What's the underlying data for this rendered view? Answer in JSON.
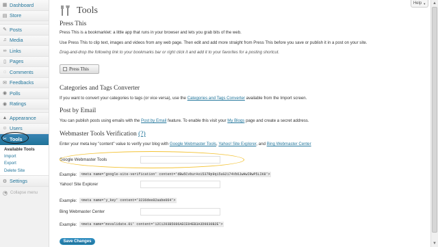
{
  "sidebar": {
    "dashboard": "Dashboard",
    "store": "Store",
    "posts": "Posts",
    "media": "Media",
    "links": "Links",
    "pages": "Pages",
    "comments": "Comments",
    "feedbacks": "Feedbacks",
    "polls": "Polls",
    "ratings": "Ratings",
    "appearance": "Appearance",
    "users": "Users",
    "tools": "Tools",
    "submenu": {
      "available_tools": "Available Tools",
      "import": "Import",
      "export": "Export",
      "delete_site": "Delete Site"
    },
    "settings": "Settings",
    "collapse": "Collapse menu"
  },
  "help": "Help",
  "page": {
    "title": "Tools",
    "press_this": {
      "heading": "Press This",
      "p1": "Press This is a bookmarklet: a little app that runs in your browser and lets you grab bits of the web.",
      "p2": "Use Press This to clip text, images and videos from any web page. Then edit and add more straight from Press This before you save or publish it in a post on your site.",
      "p3": "Drag-and-drop the following link to your bookmarks bar or right click it and add it to your favorites for a posting shortcut.",
      "button": "Press This"
    },
    "converter": {
      "heading": "Categories and Tags Converter",
      "text_before": "If you want to convert your categories to tags (or vice versa), use the",
      "link": "Categories and Tags Converter",
      "text_after": "available from the Import screen."
    },
    "post_by_email": {
      "heading": "Post by Email",
      "text_before": "You can publish posts using emails with the",
      "link": "Post by Email",
      "text_mid": "feature. To enable this visit your",
      "link2": "My Blogs",
      "text_after": "page and create a secret address."
    },
    "webmaster": {
      "heading": "Webmaster Tools Verification",
      "help_link": "(?)",
      "intro_before": "Enter your meta key \"content\" value to verify your blog with",
      "google_link": "Google Webmaster Tools",
      "yahoo_link": "Yahoo! Site Explorer",
      "and": ", and",
      "bing_link": "Bing Webmaster Center",
      "google_label": "Google Webmaster Tools",
      "google_value": "",
      "google_example_label": "Example:",
      "google_example": "<meta name='google-site-verification' content='dBw5CvburAxi537Rp9qi5uG2174Vb6JwHwIRwP5LIK8'>",
      "yahoo_label": "Yahoo! Site Explorer",
      "yahoo_value": "",
      "yahoo_example_label": "Example:",
      "yahoo_example": "<meta name='y_key' content='3236dee82aabe064'>",
      "bing_label": "Bing Webmaster Center",
      "bing_value": "",
      "bing_example_label": "Example:",
      "bing_example": "<meta name='msvalidate.01' content='12C1203B5086AECE94EB3A3D9830B2E'>"
    },
    "save": "Save Changes"
  }
}
